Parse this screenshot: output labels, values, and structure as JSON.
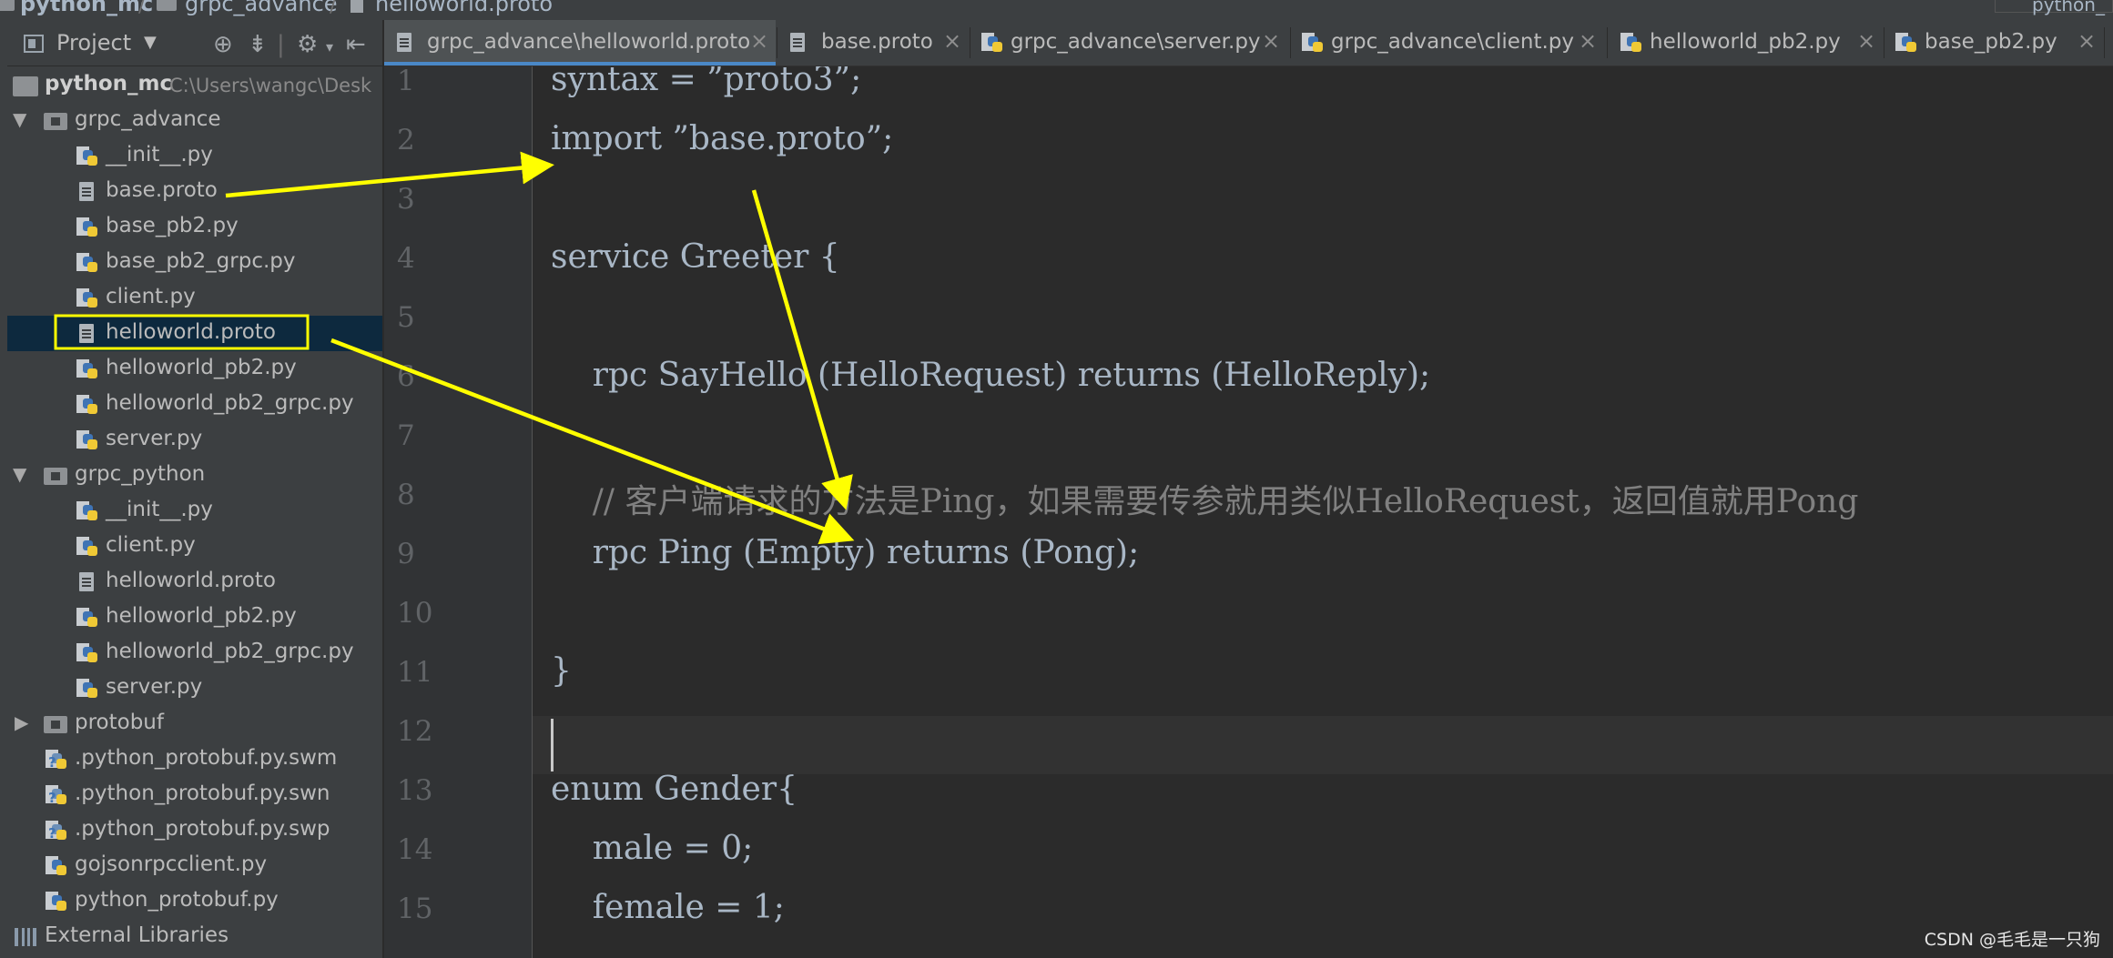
{
  "breadcrumb": {
    "items": [
      "python_mc",
      "grpc_advance",
      "helloworld.proto"
    ],
    "right_label": "python_"
  },
  "sidebar": {
    "title": "Project",
    "tree": [
      {
        "label": "python_mc",
        "path": "C:\\Users\\wangc\\Desk",
        "kind": "root"
      },
      {
        "label": "grpc_advance",
        "kind": "folder"
      },
      {
        "label": "__init__.py",
        "kind": "py"
      },
      {
        "label": "base.proto",
        "kind": "proto"
      },
      {
        "label": "base_pb2.py",
        "kind": "py"
      },
      {
        "label": "base_pb2_grpc.py",
        "kind": "py"
      },
      {
        "label": "client.py",
        "kind": "py"
      },
      {
        "label": "helloworld.proto",
        "kind": "proto",
        "selected": true
      },
      {
        "label": "helloworld_pb2.py",
        "kind": "py"
      },
      {
        "label": "helloworld_pb2_grpc.py",
        "kind": "py"
      },
      {
        "label": "server.py",
        "kind": "py"
      },
      {
        "label": "grpc_python",
        "kind": "folder"
      },
      {
        "label": "__init__.py",
        "kind": "py"
      },
      {
        "label": "client.py",
        "kind": "py"
      },
      {
        "label": "helloworld.proto",
        "kind": "proto"
      },
      {
        "label": "helloworld_pb2.py",
        "kind": "py"
      },
      {
        "label": "helloworld_pb2_grpc.py",
        "kind": "py"
      },
      {
        "label": "server.py",
        "kind": "py"
      },
      {
        "label": "protobuf",
        "kind": "folder-collapsed"
      },
      {
        "label": ".python_protobuf.py.swm",
        "kind": "pyq"
      },
      {
        "label": ".python_protobuf.py.swn",
        "kind": "pyq"
      },
      {
        "label": ".python_protobuf.py.swp",
        "kind": "pyq"
      },
      {
        "label": "gojsonrpcclient.py",
        "kind": "py"
      },
      {
        "label": "python_protobuf.py",
        "kind": "py"
      },
      {
        "label": "External Libraries",
        "kind": "lib"
      }
    ]
  },
  "tabs": [
    {
      "label": "grpc_advance\\helloworld.proto",
      "kind": "proto",
      "active": true
    },
    {
      "label": "base.proto",
      "kind": "proto"
    },
    {
      "label": "grpc_advance\\server.py",
      "kind": "py"
    },
    {
      "label": "grpc_advance\\client.py",
      "kind": "py"
    },
    {
      "label": "helloworld_pb2.py",
      "kind": "py"
    },
    {
      "label": "base_pb2.py",
      "kind": "py"
    }
  ],
  "editor": {
    "line_numbers": [
      "1",
      "2",
      "3",
      "4",
      "5",
      "6",
      "7",
      "8",
      "9",
      "10",
      "11",
      "12",
      "13",
      "14",
      "15"
    ],
    "lines": [
      "syntax = ”proto3”;",
      "import ”base.proto”;",
      "",
      "service Greeter {",
      "",
      "    rpc SayHello (HelloRequest) returns (HelloReply);",
      "",
      "    // 客户端请求的方法是Ping，如果需要传参就用类似HelloRequest，返回值就用Pong",
      "    rpc Ping (Empty) returns (Pong);",
      "",
      "}",
      "",
      "enum Gender{",
      "    male = 0;",
      "    female = 1;"
    ],
    "current_line": 12
  },
  "colors": {
    "annotation": "#ffff00",
    "accent": "#4a88c7",
    "selection": "#0d293e"
  },
  "watermark": "CSDN @毛毛是一只狗"
}
